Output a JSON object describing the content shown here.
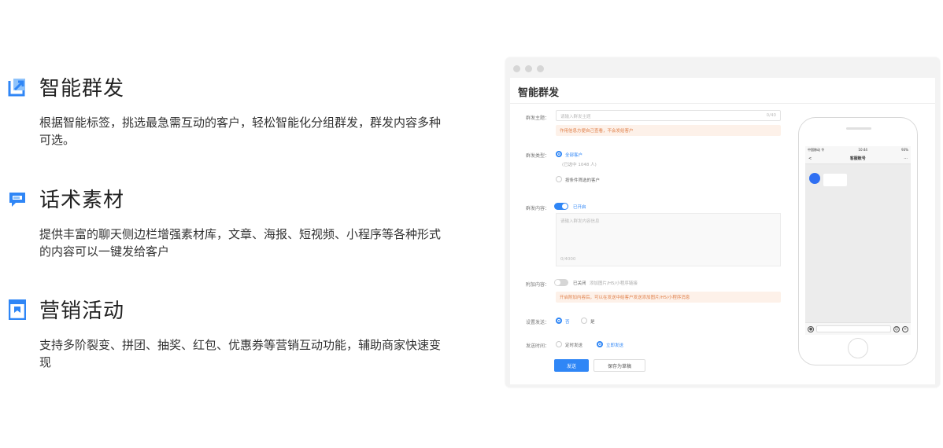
{
  "features": [
    {
      "icon": "edit-square-icon",
      "title": "智能群发",
      "desc": "根据智能标签，挑选最急需互动的客户，轻松智能化分组群发，群发内容多种可选。"
    },
    {
      "icon": "chat-bubble-icon",
      "title": "话术素材",
      "desc": "提供丰富的聊天侧边栏增强素材库，文章、海报、短视频、小程序等各种形式的内容可以一键发给客户"
    },
    {
      "icon": "bookmark-icon",
      "title": "营销活动",
      "desc": "支持多阶裂变、拼团、抽奖、红包、优惠券等营销互动功能，辅助商家快速变现"
    }
  ],
  "window": {
    "title": "智能群发",
    "form": {
      "theme_label": "群发主题：",
      "theme_placeholder": "请输入群发主题",
      "theme_count": "0/40",
      "theme_hint": "作用信息方便自己查看，不会发给客户",
      "type_label": "群发类型：",
      "type_option_all": "全部客户",
      "type_option_all_sub": "(已选中 1048 人)",
      "type_option_filter": "按条件筛选的客户",
      "content_label": "群发内容：",
      "content_toggle_label": "已开启",
      "content_placeholder": "请输入群发内容信息",
      "content_count": "0/4000",
      "attach_label": "附加内容：",
      "attach_toggle_label": "已关闭",
      "attach_hint_inline": "添加图片/H5/小程序链接",
      "attach_warn": "开启附加内容后，可以在发送中给客户发送添加图片/H5/小程序消息",
      "repeat_label": "设置发送：",
      "repeat_yes": "否",
      "repeat_no": "是",
      "time_label": "发送时间：",
      "time_scheduled": "定时发送",
      "time_now": "立即发送",
      "send_button": "发送",
      "draft_button": "保存为草稿"
    },
    "phone": {
      "carrier": "中国移动 令",
      "time": "10:44",
      "battery": "93%",
      "nav_back": "<",
      "nav_title": "客服账号",
      "nav_more": "···"
    }
  },
  "colors": {
    "accent": "#2f86f6",
    "warn_bg": "#fdf1e9",
    "warn_text": "#e0804a"
  }
}
